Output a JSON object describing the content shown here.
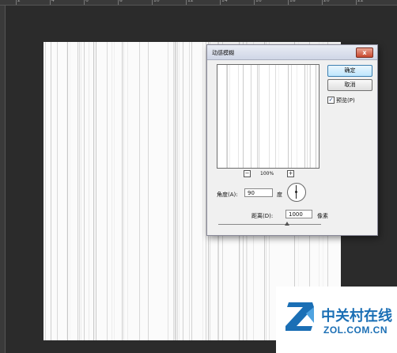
{
  "dialog": {
    "title": "动感模糊",
    "close_label": "x",
    "ok_label": "确定",
    "cancel_label": "取消",
    "preview_label": "预览(P)",
    "preview_checked": true,
    "zoom_out_label": "−",
    "zoom_level": "100%",
    "zoom_in_label": "+",
    "angle_label": "角度(A):",
    "angle_value": "90",
    "angle_unit": "度",
    "distance_label": "距离(D):",
    "distance_value": "1000",
    "distance_unit": "像素"
  },
  "ruler": {
    "top_numbers": [
      "2",
      "4",
      "6",
      "8",
      "10",
      "12",
      "14",
      "16",
      "18",
      "20",
      "22"
    ]
  },
  "watermark": {
    "name_cn": "中关村在线",
    "name_en": "ZOL.COM.CN",
    "brand_color": "#1b6fb5"
  },
  "colors": {
    "workspace": "#2b2b2b",
    "canvas": "#fbfbfb",
    "dialog_bg": "#f0f0f0",
    "close_button": "#c9492f"
  }
}
